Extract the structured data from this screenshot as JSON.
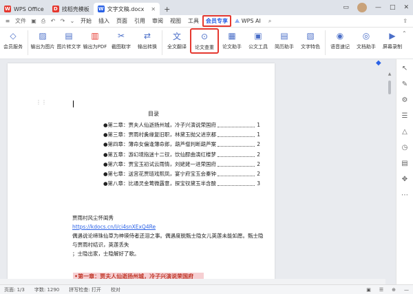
{
  "tabs": [
    {
      "label": "WPS Office",
      "icon": "wps-logo-icon",
      "color": "#e5372e"
    },
    {
      "label": "找稻壳模板",
      "icon": "docer-logo-icon",
      "color": "#e5372e"
    },
    {
      "label": "文字文稿.docx",
      "icon": "word-doc-icon",
      "color": "#2b62e6"
    }
  ],
  "menu": {
    "items": [
      "开始",
      "插入",
      "页面",
      "引用",
      "审阅",
      "视图",
      "工具",
      "会员专享",
      "WPS AI"
    ],
    "active": "会员专享"
  },
  "ribbon": {
    "buttons": [
      "会员服务",
      "输出为图片",
      "图片转文字",
      "输出为PDF",
      "截图取字",
      "输出转换",
      "全文翻译",
      "论文查重",
      "论文助手",
      "公文工具",
      "简历助手",
      "文字特色",
      "语音速记",
      "文档助手",
      "屏幕录制"
    ],
    "highlighted": "论文查重"
  },
  "document": {
    "toc_title": "目录",
    "toc": [
      {
        "text": "●第二章：贾夫人仙逝扬州城，冷子兴演说荣国府",
        "page": "1"
      },
      {
        "text": "●第三章：贾雨村夤缘复旧职，林黛玉抛父进京都",
        "page": "1"
      },
      {
        "text": "●第四章：薄命女偏逢薄命郎，葫芦僧判断葫芦案",
        "page": "2"
      },
      {
        "text": "●第五章：游幻境指迷十二钗，饮仙醪曲演红楼梦",
        "page": "2"
      },
      {
        "text": "●第六章：贾宝玉初试云雨情，刘姥姥一进荣国府",
        "page": "2"
      },
      {
        "text": "●第七章：送宫花贾琏戏熙凤，宴宁府宝玉会秦钟",
        "page": "2"
      },
      {
        "text": "●第八章：比通灵金莺微露意，探宝钗黛玉半含酸",
        "page": "3"
      }
    ],
    "para1": "贾雨村风尘怀闺秀",
    "link": "https://kdocs.cn/l/ci4snXExQ4Re",
    "para2": "偶遇说论缔珠仙草为神瑛侍者还泪之事。偶遇度脱甄士隐女儿英莲未能如愿。甄士隐与贾雨村结识，英莲丢失",
    "para3": "；士隐出家，士隐解好了歌。",
    "heading": "•第一章：贾夫人仙逝扬州城，冷子兴演说荣国府"
  },
  "status": {
    "page": "页面: 1/3",
    "wordcount": "字数: 1290",
    "spellcheck": "拼写检查: 打开",
    "proofread": "校对"
  }
}
